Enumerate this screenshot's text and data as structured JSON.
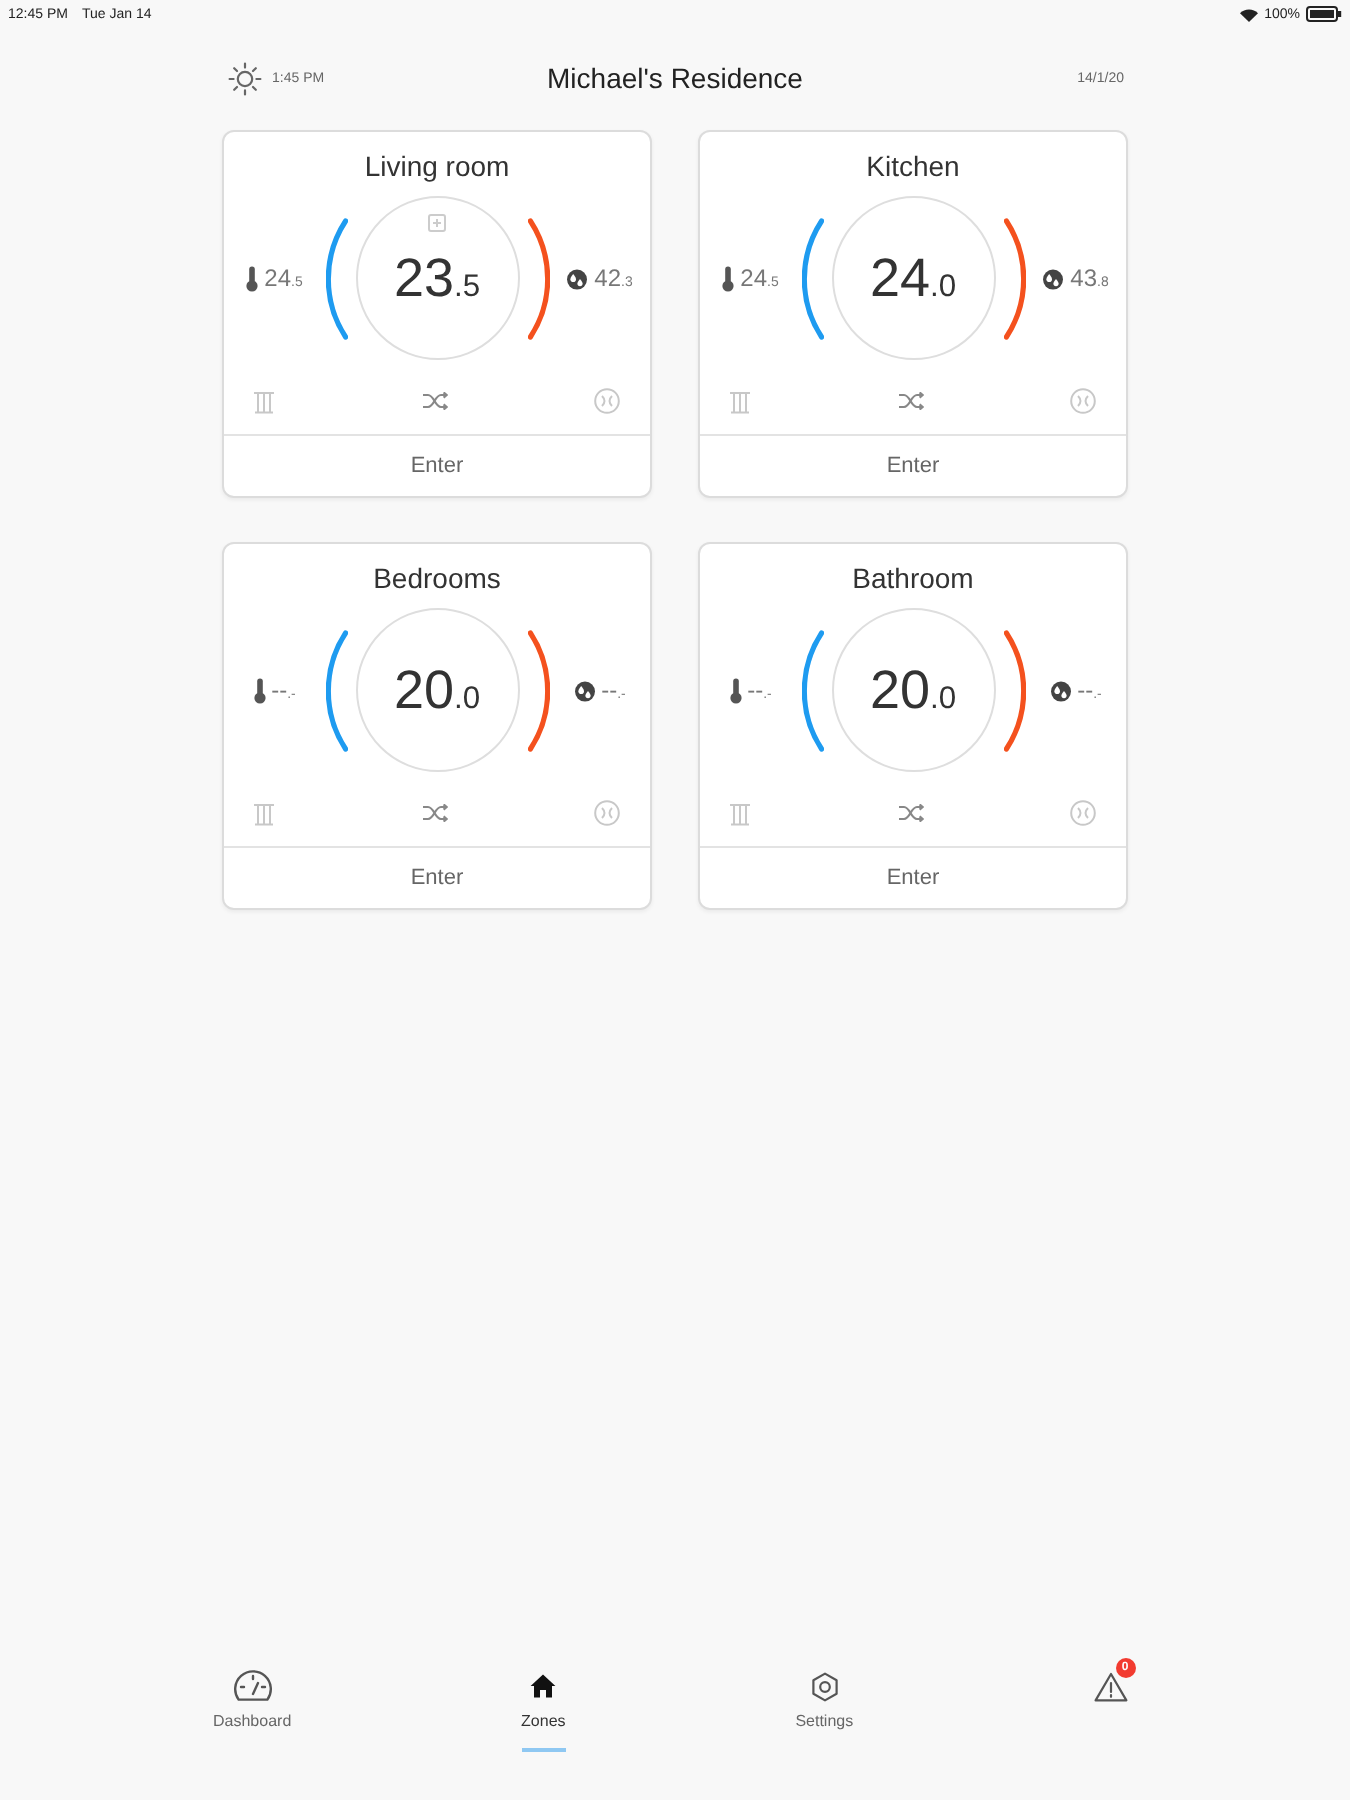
{
  "status_bar": {
    "time": "12:45 PM",
    "date": "Tue Jan 14",
    "battery": "100%"
  },
  "header": {
    "time": "1:45 PM",
    "title": "Michael's Residence",
    "date": "14/1/20"
  },
  "zones": [
    {
      "name": "Living room",
      "temperature": "24$_{.5}$",
      "indicator": true,
      "setpoint": "23$_{.5}$",
      "humidity": "42$_{.3}$",
      "action": "Enter"
    },
    {
      "name": "Kitchen",
      "temperature": "24$_{.5}$",
      "indicator": false,
      "setpoint": "24$_{.0}$",
      "humidity": "43$_{.8}$",
      "action": "Enter"
    },
    {
      "name": "Bedrooms",
      "temperature": "--$_{.-}$",
      "indicator": false,
      "setpoint": "20$_{.0}$",
      "humidity": "--$_{.-}$",
      "action": "Enter"
    },
    {
      "name": "Bathroom",
      "temperature": "--$_{.-}$",
      "indicator": false,
      "setpoint": "20$_{.0}$",
      "humidity": "--$_{.-}$",
      "action": "Enter"
    }
  ],
  "nav": [
    {
      "label": "Dashboard",
      "selected": false
    },
    {
      "label": "Zones",
      "selected": true
    },
    {
      "label": "Settings",
      "selected": false
    },
    {
      "badge": "0",
      "selected": false
    }
  ]
}
